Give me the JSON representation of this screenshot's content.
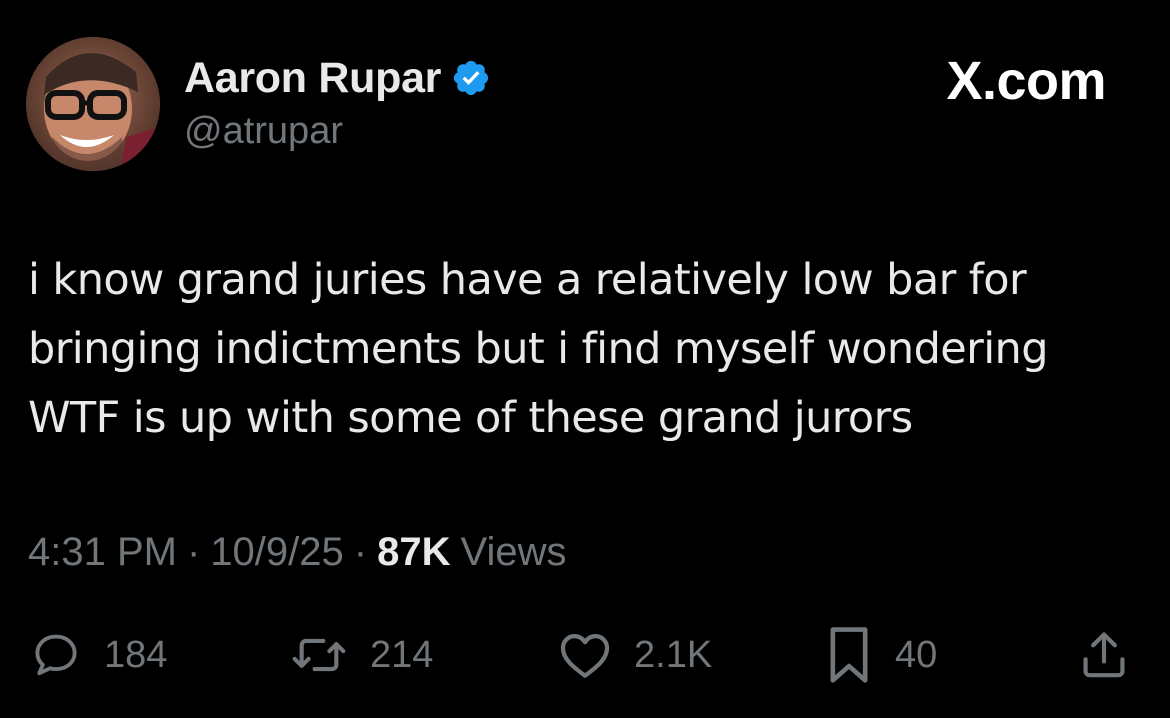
{
  "header": {
    "display_name": "Aaron Rupar",
    "handle": "@atrupar",
    "verified": true,
    "brand": "X.com"
  },
  "tweet": {
    "lines": [
      "i know grand juries have a relatively low bar for",
      "bringing indictments but i find myself wondering",
      "WTF is up with some of these grand jurors"
    ]
  },
  "meta": {
    "time": "4:31 PM",
    "separator": "·",
    "date": "10/9/25",
    "views_count": "87K",
    "views_label": "Views"
  },
  "actions": {
    "replies": "184",
    "reposts": "214",
    "likes": "2.1K",
    "bookmarks": "40"
  },
  "icons": {
    "reply": "speech-bubble-icon",
    "repost": "repost-arrows-icon",
    "like": "heart-icon",
    "bookmark": "bookmark-icon",
    "share": "share-upload-icon",
    "verified": "verified-badge-icon"
  },
  "colors": {
    "background": "#000000",
    "text": "#e7e9ea",
    "muted": "#71767b",
    "verified": "#1d9bf0"
  }
}
